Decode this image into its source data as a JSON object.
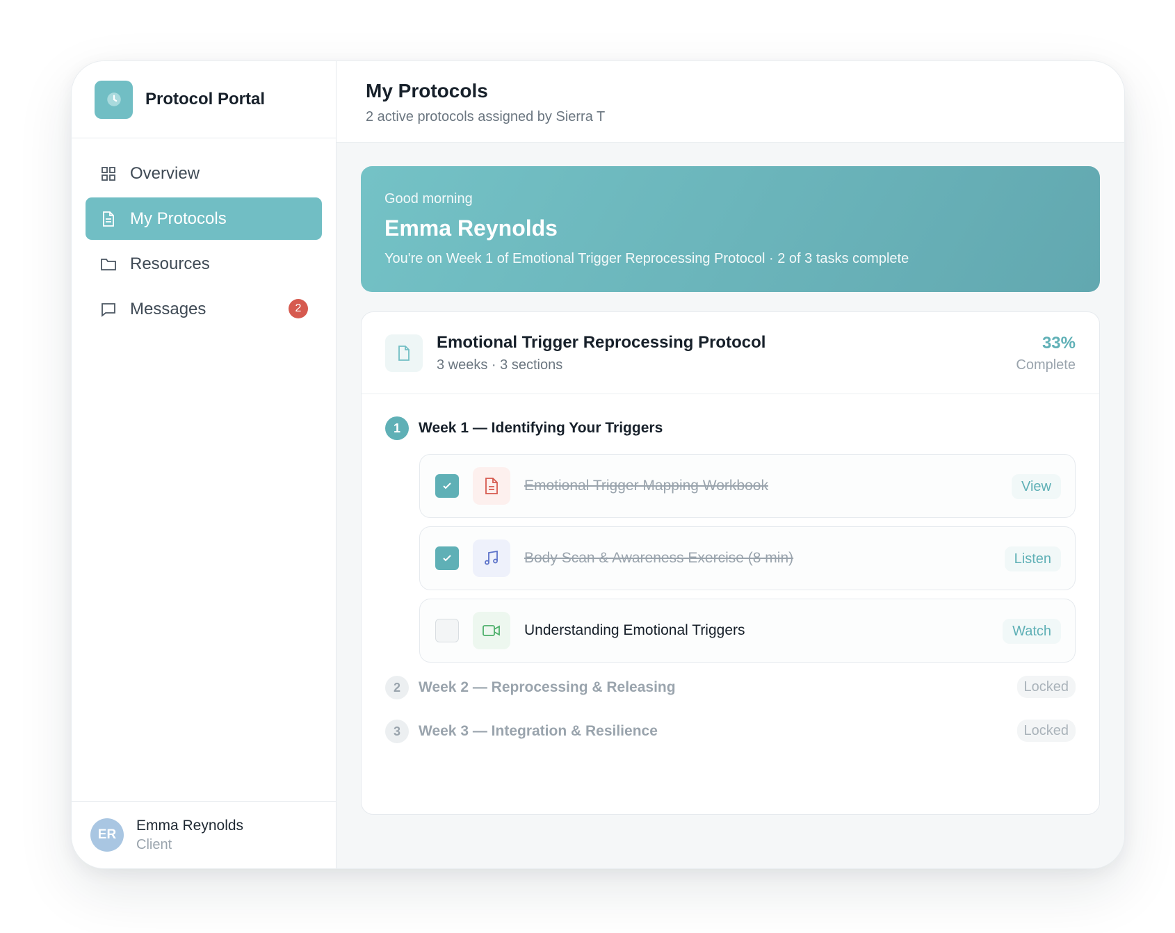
{
  "brand": {
    "title": "Protocol Portal",
    "logo_icon": "clock-icon"
  },
  "sidebar": {
    "items": [
      {
        "label": "Overview",
        "icon": "grid-icon"
      },
      {
        "label": "My Protocols",
        "icon": "document-icon",
        "active": true
      },
      {
        "label": "Resources",
        "icon": "folder-icon"
      },
      {
        "label": "Messages",
        "icon": "message-icon",
        "badge": "2"
      }
    ]
  },
  "user": {
    "initials": "ER",
    "name": "Emma Reynolds",
    "role": "Client"
  },
  "header": {
    "title": "My Protocols",
    "subtitle": "2 active protocols assigned by Sierra T"
  },
  "hero": {
    "greeting": "Good morning",
    "name": "Emma Reynolds",
    "line": "You're on Week 1 of Emotional Trigger Reprocessing Protocol · 2 of 3 tasks complete"
  },
  "protocol": {
    "title": "Emotional Trigger Reprocessing Protocol",
    "meta": "3 weeks · 3 sections",
    "percent": "33%",
    "percent_label": "Complete",
    "progress": 0.33
  },
  "weeks": [
    {
      "number": "1",
      "label": "Week 1 — Identifying Your Triggers",
      "tasks": [
        {
          "label": "Emotional Trigger Mapping Workbook",
          "action": "View",
          "done": true,
          "icon": "document-icon"
        },
        {
          "label": "Body Scan & Awareness Exercise (8 min)",
          "action": "Listen",
          "done": true,
          "icon": "music-icon"
        },
        {
          "label": "Understanding Emotional Triggers",
          "action": "Watch",
          "done": false,
          "icon": "video-icon"
        }
      ]
    },
    {
      "number": "2",
      "label": "Week 2 — Reprocessing & Releasing",
      "status": "Locked"
    },
    {
      "number": "3",
      "label": "Week 3 — Integration & Resilience",
      "status": "Locked"
    }
  ],
  "colors": {
    "accent": "#71bec4",
    "accent_dark": "#5fb0b6",
    "badge": "#d65a4f",
    "doc_icon_bg": "#fdf0ee",
    "doc_icon": "#d65a4f",
    "music_icon_bg": "#eef1fb",
    "music_icon": "#5b72c9",
    "video_icon_bg": "#edf7ef",
    "video_icon": "#4caf6a"
  }
}
